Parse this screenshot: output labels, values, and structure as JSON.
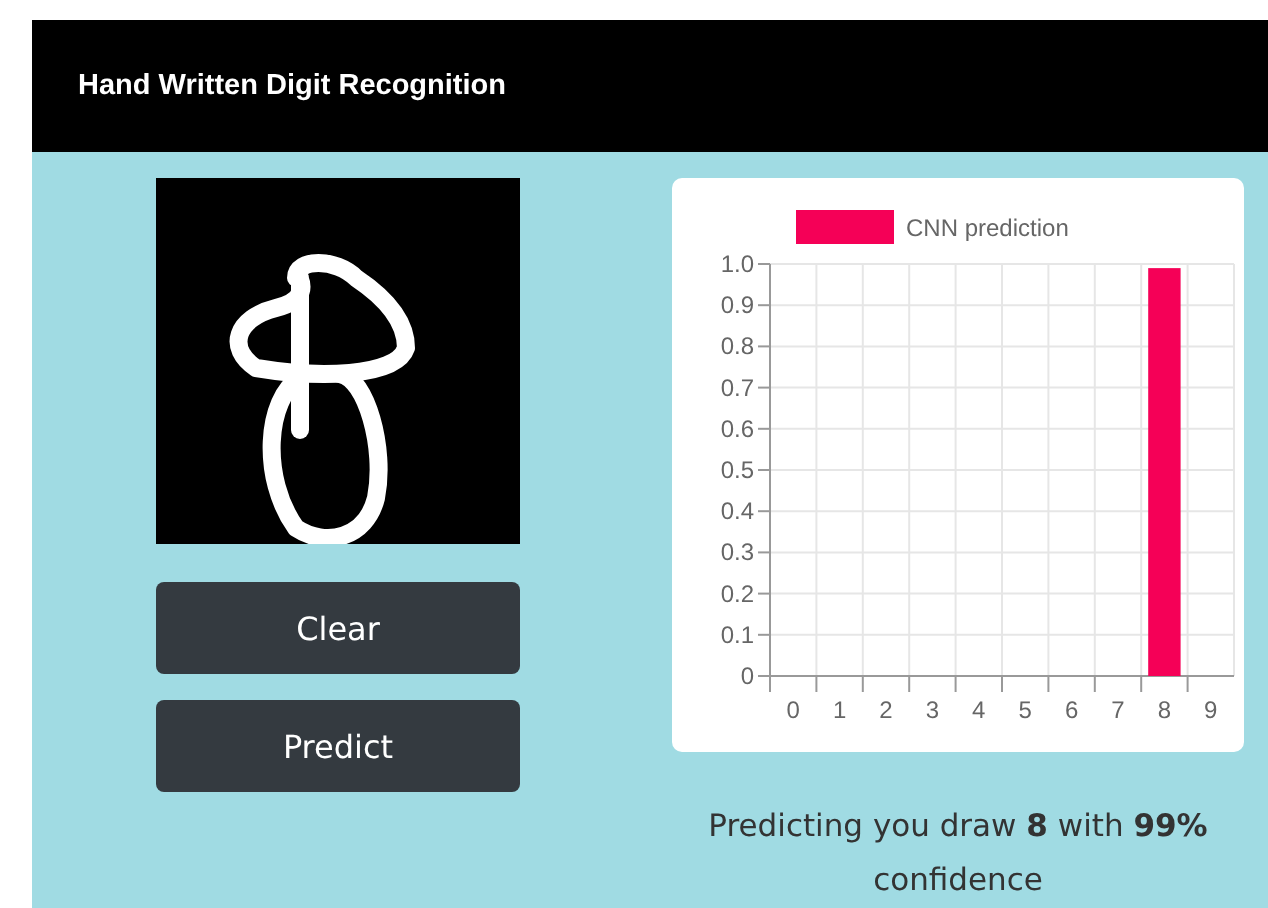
{
  "header": {
    "title": "Hand Written Digit Recognition"
  },
  "buttons": [
    {
      "label": "Clear"
    },
    {
      "label": "Predict"
    }
  ],
  "chart": {
    "chart_data": {
      "type": "bar",
      "categories": [
        "0",
        "1",
        "2",
        "3",
        "4",
        "5",
        "6",
        "7",
        "8",
        "9"
      ],
      "series": [
        {
          "name": "CNN prediction",
          "color": "#f50057",
          "values": [
            0,
            0,
            0,
            0,
            0,
            0,
            0,
            0,
            0.99,
            0
          ]
        }
      ],
      "ylim": [
        0,
        1
      ],
      "grid": true,
      "yticks": [
        0,
        {
          "value": 0.1,
          "label": "0.1"
        },
        {
          "value": 0.2,
          "label": "0.2"
        },
        {
          "value": 0.3,
          "label": "0.3"
        },
        {
          "value": 0.4,
          "label": "0.4"
        },
        {
          "value": 0.5,
          "label": "0.5"
        },
        {
          "value": 0.6,
          "label": "0.6"
        },
        {
          "value": 0.7,
          "label": "0.7"
        },
        {
          "value": 0.8,
          "label": "0.8"
        },
        {
          "value": 0.9,
          "label": "0.9"
        },
        {
          "value": 1,
          "label": "1.0"
        }
      ]
    }
  },
  "result": {
    "text": "Predicting you draw **8** with **99%** confidence"
  }
}
